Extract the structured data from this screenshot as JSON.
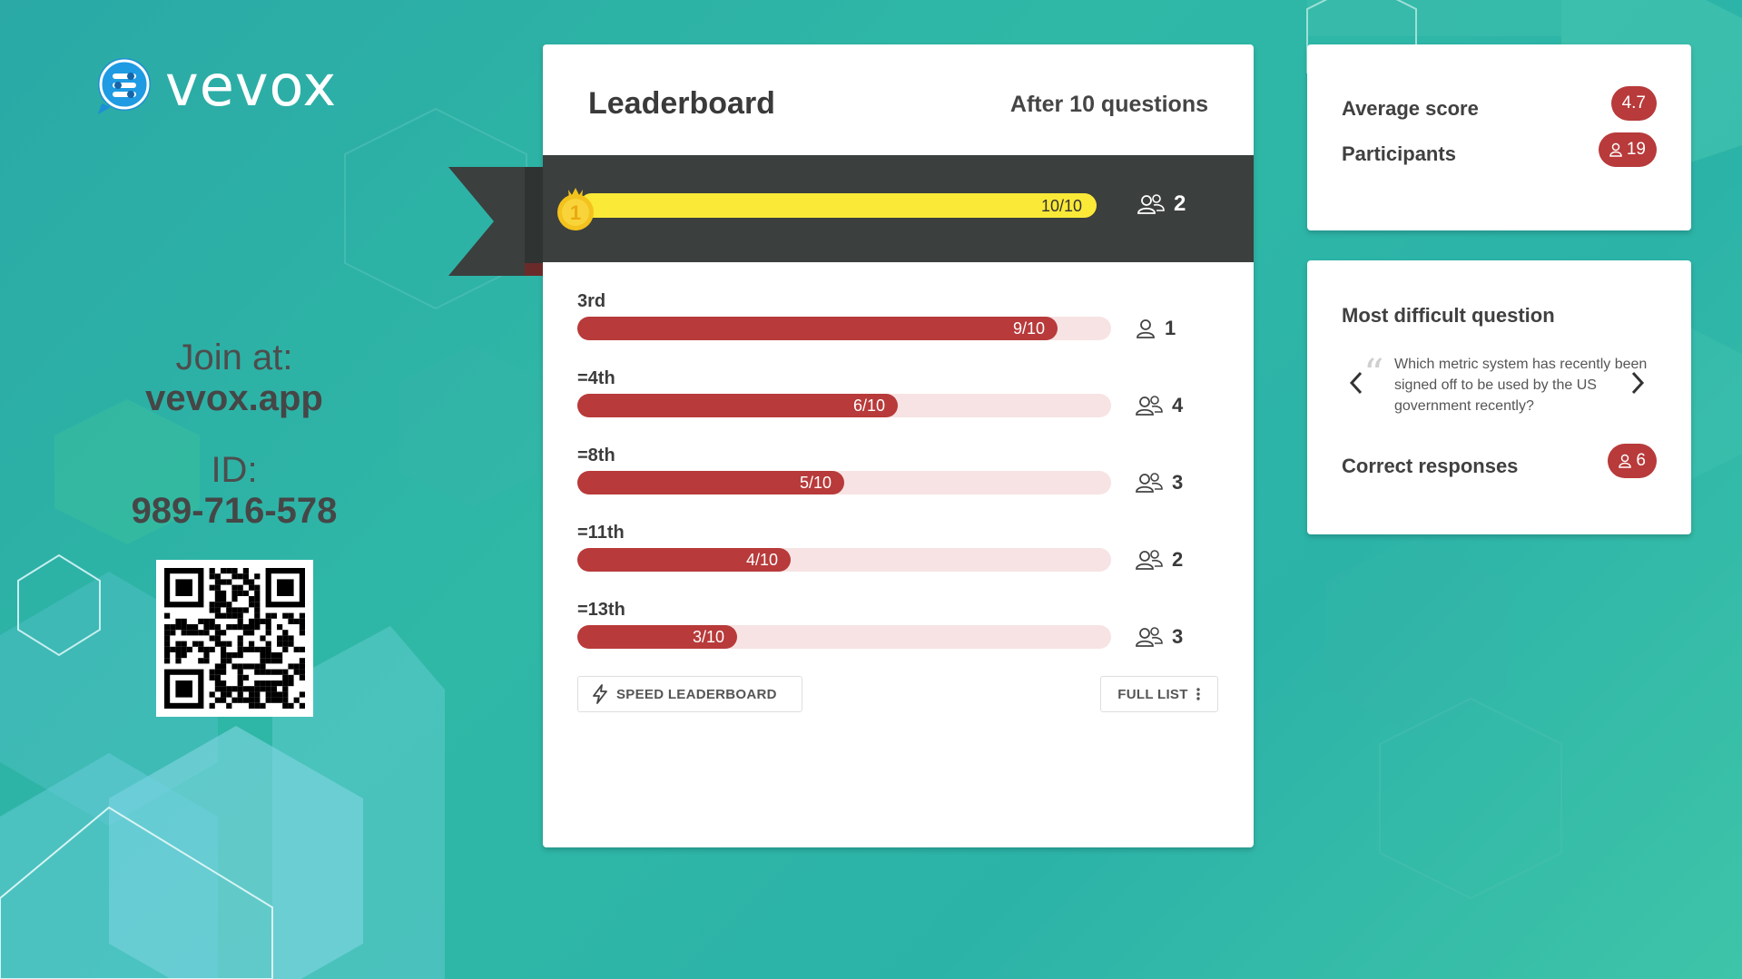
{
  "brand": {
    "name": "vevox",
    "accent": "#b83a3a",
    "banner_color": "#3b3f3e",
    "first_bar_color": "#fbe938"
  },
  "join": {
    "label": "Join at:",
    "url": "vevox.app",
    "id_label": "ID:",
    "id_value": "989-716-578"
  },
  "leaderboard": {
    "title": "Leaderboard",
    "subtitle": "After 10 questions",
    "first": {
      "rank": "1",
      "score": "10/10",
      "fraction": 1.0,
      "count": "2"
    },
    "rows": [
      {
        "rank": "3rd",
        "score": "9/10",
        "fraction": 0.9,
        "count": "1",
        "icon": "single-user-icon"
      },
      {
        "rank": "=4th",
        "score": "6/10",
        "fraction": 0.6,
        "count": "4",
        "icon": "group-icon"
      },
      {
        "rank": "=8th",
        "score": "5/10",
        "fraction": 0.5,
        "count": "3",
        "icon": "group-icon"
      },
      {
        "rank": "=11th",
        "score": "4/10",
        "fraction": 0.4,
        "count": "2",
        "icon": "group-icon"
      },
      {
        "rank": "=13th",
        "score": "3/10",
        "fraction": 0.3,
        "count": "3",
        "icon": "group-icon"
      }
    ],
    "speed_button": "SPEED LEADERBOARD",
    "full_list_button": "FULL LIST"
  },
  "stats": {
    "average_label": "Average score",
    "average_value": "4.7",
    "participants_label": "Participants",
    "participants_value": "19"
  },
  "difficult": {
    "title": "Most difficult question",
    "question": "Which metric system has recently been signed off to be used by the US government recently?",
    "correct_label": "Correct responses",
    "correct_value": "6"
  }
}
